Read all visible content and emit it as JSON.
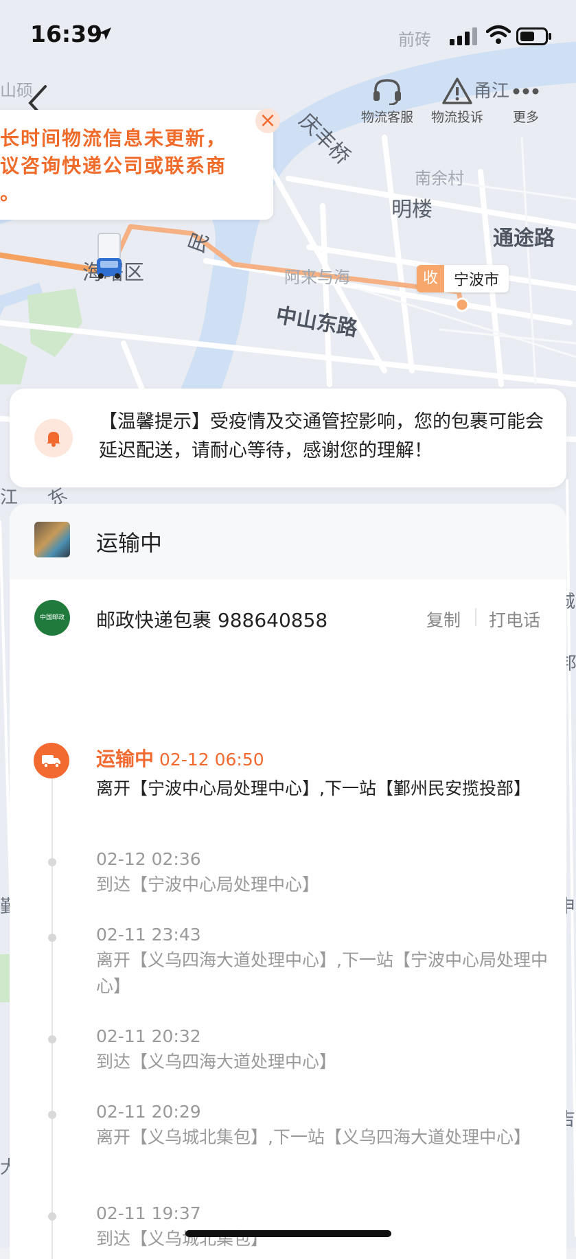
{
  "status_bar": {
    "time": "16:39"
  },
  "top_actions": [
    {
      "label": "物流客服",
      "icon": "headset-icon"
    },
    {
      "label": "物流投诉",
      "icon": "warning-icon"
    },
    {
      "label": "更多",
      "icon": "more-icon"
    }
  ],
  "notice": {
    "text": "长时间物流信息未更新，\n议咨询快递公司或联系商\n。"
  },
  "map": {
    "labels": [
      "甬江",
      "庆丰桥",
      "南余村",
      "明楼",
      "通途路",
      "民",
      "海曙区",
      "阿来与海",
      "中山东路",
      "江",
      "东",
      "城",
      "邦",
      "鄞",
      "大",
      "申",
      "吉",
      "山硕",
      "前砖"
    ],
    "destination": {
      "tag": "收",
      "name": "宁波市"
    }
  },
  "tip": {
    "text": "【温馨提示】受疫情及交通管控影响，您的包裹可能会延迟配送，请耐心等待，感谢您的理解！"
  },
  "package": {
    "status": "运输中",
    "courier": "邮政快递包裹 988640858",
    "logo_text": "中国邮政",
    "copy_label": "复制",
    "call_label": "打电话"
  },
  "timeline": {
    "current": {
      "status": "运输中",
      "time": "02-12 06:50",
      "desc": "离开【宁波中心局处理中心】,下一站【鄞州民安揽投部】"
    },
    "events": [
      {
        "time": "02-12 02:36",
        "desc": "到达【宁波中心局处理中心】"
      },
      {
        "time": "02-11 23:43",
        "desc": "离开【义乌四海大道处理中心】,下一站【宁波中心局处理中心】"
      },
      {
        "time": "02-11 20:32",
        "desc": "到达【义乌四海大道处理中心】"
      },
      {
        "time": "02-11 20:29",
        "desc": "离开【义乌城北集包】,下一站【义乌四海大道处理中心】"
      },
      {
        "time": "02-11 19:37",
        "desc": "到达【义乌城北集包】"
      }
    ]
  },
  "colors": {
    "accent": "#f26a30",
    "route": "#f5b183",
    "river": "#cfe0f5",
    "park": "#cfe8cc"
  }
}
